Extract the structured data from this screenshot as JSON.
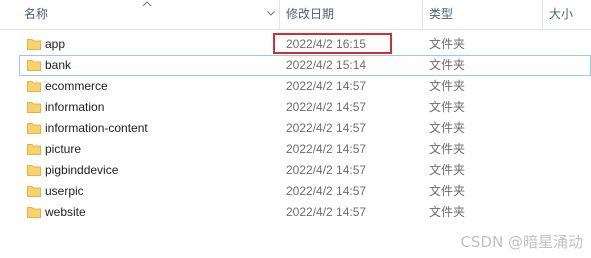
{
  "columns": {
    "name": "名称",
    "date_modified": "修改日期",
    "type": "类型",
    "size": "大小"
  },
  "files": [
    {
      "name": "app",
      "date": "2022/4/2 16:15",
      "type": "文件夹"
    },
    {
      "name": "bank",
      "date": "2022/4/2 15:14",
      "type": "文件夹"
    },
    {
      "name": "ecommerce",
      "date": "2022/4/2 14:57",
      "type": "文件夹"
    },
    {
      "name": "information",
      "date": "2022/4/2 14:57",
      "type": "文件夹"
    },
    {
      "name": "information-content",
      "date": "2022/4/2 14:57",
      "type": "文件夹"
    },
    {
      "name": "picture",
      "date": "2022/4/2 14:57",
      "type": "文件夹"
    },
    {
      "name": "pigbinddevice",
      "date": "2022/4/2 14:57",
      "type": "文件夹"
    },
    {
      "name": "userpic",
      "date": "2022/4/2 14:57",
      "type": "文件夹"
    },
    {
      "name": "website",
      "date": "2022/4/2 14:57",
      "type": "文件夹"
    }
  ],
  "icons": {
    "sort": "sort-ascending-icon",
    "column_menu": "chevron-down-icon",
    "folder": "folder-icon"
  },
  "colors": {
    "folder": "#f7d36b",
    "folder_dark": "#e0b44a",
    "header_text": "#4c607a",
    "highlight": "#c83232",
    "focus_border": "#99c9ef"
  },
  "watermark": "CSDN @暗星涌动"
}
